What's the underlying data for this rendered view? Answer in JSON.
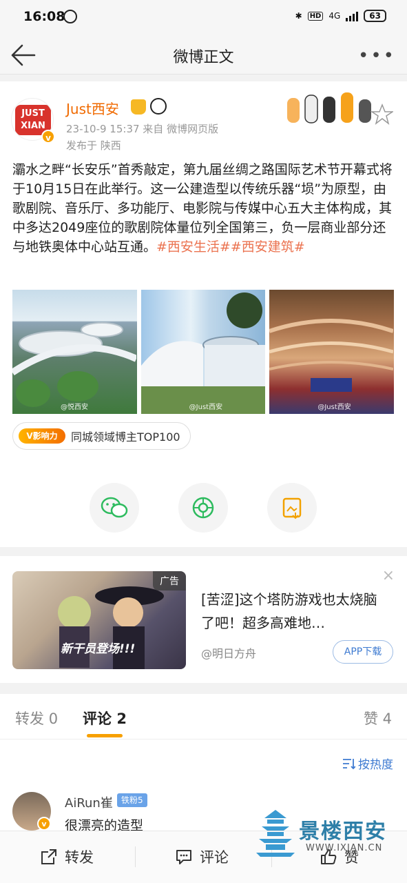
{
  "status_bar": {
    "time": "16:08",
    "network": "4G",
    "battery": "63",
    "hd": "HD"
  },
  "nav": {
    "title": "微博正文"
  },
  "post": {
    "username": "Just西安",
    "avatar_text": "JUST XIAN",
    "time_source": "23-10-9 15:37  来自 微博网页版",
    "location": "发布于 陕西",
    "text": "灞水之畔“长安乐”首秀敲定，第九届丝绸之路国际艺术节开幕式将于10月15日在此举行。这一公建造型以传统乐器“埙”为原型，由歌剧院、音乐厅、多功能厅、电影院与传媒中心五大主体构成，其中多达2049座位的歌剧院体量位列全国第三，负一层商业部分还与地铁奥体中心站互通。",
    "hashtags": "#西安生活##西安建筑#",
    "photo_watermarks": [
      "@悦西安",
      "@Just西安",
      "@Just西安"
    ],
    "badge_label": "V影响力",
    "badge_text": "同城领域博主TOP100"
  },
  "ad": {
    "label": "广告",
    "title": "[苦涩]这个塔防游戏也太烧脑了吧！超多高难地…",
    "author": "@明日方舟",
    "button": "APP下载",
    "image_text": "新干员登场!!!",
    "close": "×"
  },
  "comments": {
    "tabs": [
      {
        "label": "转发",
        "count": "0"
      },
      {
        "label": "评论",
        "count": "2"
      },
      {
        "label": "赞",
        "count": "4"
      }
    ],
    "sort_label": "按热度",
    "items": [
      {
        "name": "AiRun崔",
        "fan_badge": "铁粉5",
        "text": "很漂亮的造型"
      }
    ]
  },
  "toolbar": {
    "repost": "转发",
    "comment": "评论",
    "like": "赞"
  },
  "watermark": {
    "name": "景楼西安",
    "url": "WWW.IXIAN.CN"
  },
  "colors": {
    "orange": "#f06a00",
    "tag": "#eb7350",
    "link_blue": "#3d7ad1"
  }
}
